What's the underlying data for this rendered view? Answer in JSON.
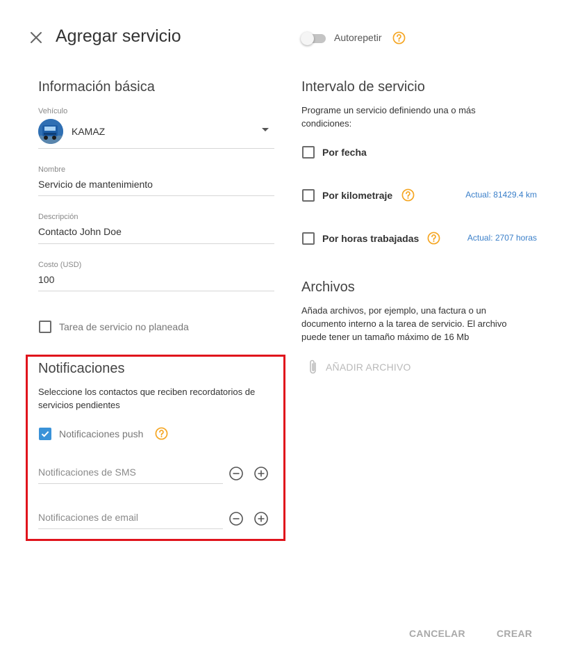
{
  "header": {
    "title": "Agregar servicio",
    "autorepeat_label": "Autorepetir"
  },
  "basic_info": {
    "heading": "Información básica",
    "vehicle": {
      "label": "Vehículo",
      "value": "KAMAZ"
    },
    "name": {
      "label": "Nombre",
      "value": "Servicio de mantenimiento"
    },
    "description": {
      "label": "Descripción",
      "value": "Contacto John Doe"
    },
    "cost": {
      "label": "Costo (USD)",
      "value": "100"
    },
    "unplanned_label": "Tarea de servicio no planeada"
  },
  "notifications": {
    "heading": "Notificaciones",
    "description": "Seleccione los contactos que reciben recordatorios de servicios pendientes",
    "push_label": "Notificaciones push",
    "push_checked": true,
    "sms_placeholder": "Notificaciones de SMS",
    "email_placeholder": "Notificaciones de email"
  },
  "service_interval": {
    "heading": "Intervalo de servicio",
    "description": "Programe un servicio definiendo una o más condiciones:",
    "by_date_label": "Por fecha",
    "by_mileage_label": "Por kilometraje",
    "by_mileage_actual": "Actual: 81429.4 km",
    "by_hours_label": "Por horas trabajadas",
    "by_hours_actual": "Actual: 2707 horas"
  },
  "files": {
    "heading": "Archivos",
    "description": "Añada archivos, por ejemplo, una factura o un documento interno a la tarea de servicio. El archivo puede tener un tamaño máximo de 16 Mb",
    "add_file_label": "AÑADIR ARCHIVO"
  },
  "footer": {
    "cancel_label": "CANCELAR",
    "create_label": "CREAR"
  },
  "colors": {
    "accent_blue": "#3a92d8",
    "help_orange": "#f5a623",
    "highlight_red": "#e0141c"
  }
}
